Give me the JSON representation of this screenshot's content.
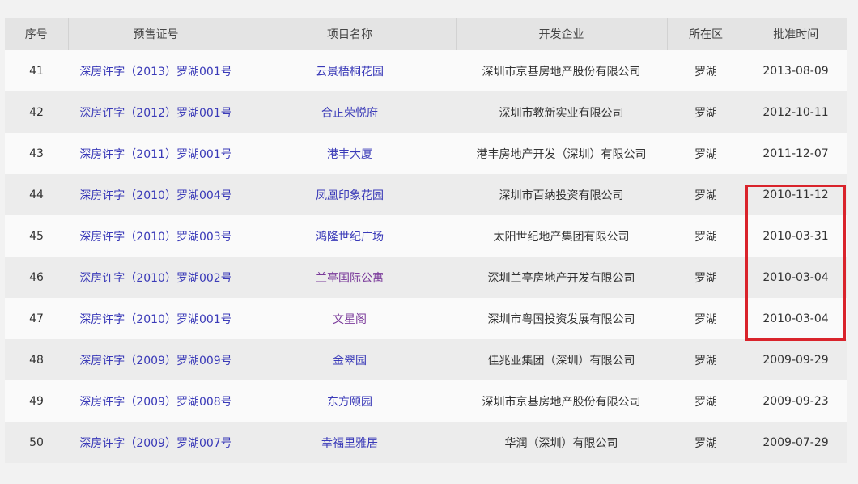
{
  "table": {
    "headers": [
      "序号",
      "预售证号",
      "项目名称",
      "开发企业",
      "所在区",
      "批准时间"
    ],
    "rows": [
      {
        "no": "41",
        "permit": "深房许字（2013）罗湖001号",
        "project": "云景梧桐花园",
        "developer": "深圳市京基房地产股份有限公司",
        "district": "罗湖",
        "date": "2013-08-09"
      },
      {
        "no": "42",
        "permit": "深房许字（2012）罗湖001号",
        "project": "合正荣悦府",
        "developer": "深圳市教新实业有限公司",
        "district": "罗湖",
        "date": "2012-10-11"
      },
      {
        "no": "43",
        "permit": "深房许字（2011）罗湖001号",
        "project": "港丰大厦",
        "developer": "港丰房地产开发（深圳）有限公司",
        "district": "罗湖",
        "date": "2011-12-07"
      },
      {
        "no": "44",
        "permit": "深房许字（2010）罗湖004号",
        "project": "凤凰印象花园",
        "developer": "深圳市百纳投资有限公司",
        "district": "罗湖",
        "date": "2010-11-12"
      },
      {
        "no": "45",
        "permit": "深房许字（2010）罗湖003号",
        "project": "鸿隆世纪广场",
        "developer": "太阳世纪地产集团有限公司",
        "district": "罗湖",
        "date": "2010-03-31"
      },
      {
        "no": "46",
        "permit": "深房许字（2010）罗湖002号",
        "project": "兰亭国际公寓",
        "developer": "深圳兰亭房地产开发有限公司",
        "district": "罗湖",
        "date": "2010-03-04"
      },
      {
        "no": "47",
        "permit": "深房许字（2010）罗湖001号",
        "project": "文星阁",
        "developer": "深圳市粤国投资发展有限公司",
        "district": "罗湖",
        "date": "2010-03-04"
      },
      {
        "no": "48",
        "permit": "深房许字（2009）罗湖009号",
        "project": "金翠园",
        "developer": "佳兆业集团（深圳）有限公司",
        "district": "罗湖",
        "date": "2009-09-29"
      },
      {
        "no": "49",
        "permit": "深房许字（2009）罗湖008号",
        "project": "东方颐园",
        "developer": "深圳市京基房地产股份有限公司",
        "district": "罗湖",
        "date": "2009-09-23"
      },
      {
        "no": "50",
        "permit": "深房许字（2009）罗湖007号",
        "project": "幸福里雅居",
        "developer": "华润（深圳）有限公司",
        "district": "罗湖",
        "date": "2009-07-29"
      }
    ]
  },
  "colors": {
    "link": "#3a3ab8",
    "visited_link": "#7a3a9a",
    "highlight": "#d9232b"
  }
}
